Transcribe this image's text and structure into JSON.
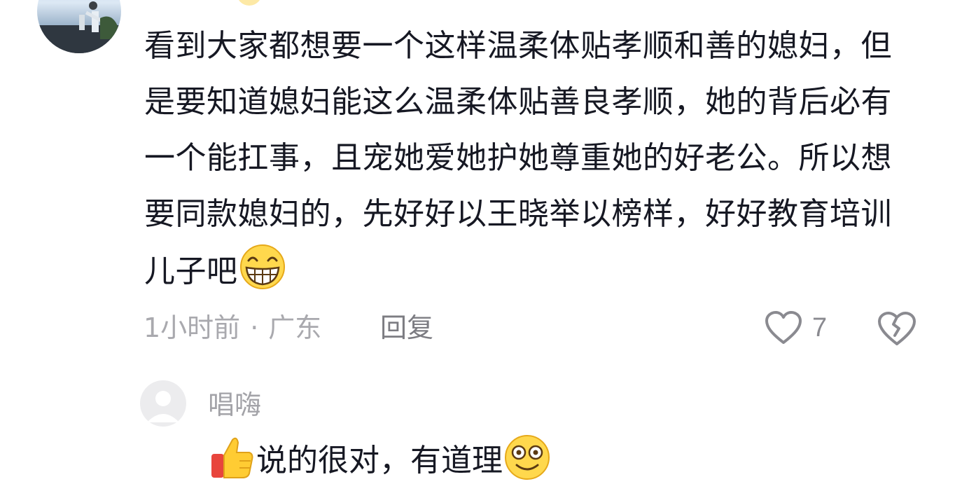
{
  "main_comment": {
    "partial_username": "",
    "text": "看到大家都想要一个这样温柔体贴孝顺和善的媳妇，但是要知道媳妇能这么温柔体贴善良孝顺，她的背后必有一个能扛事，且宠她爱她护她尊重她的好老公。所以想要同款媳妇的，先好好以王晓举以榜样，好好教育培训儿子吧",
    "trailing_emoji": "grinning-face-emoji",
    "time": "1小时前",
    "separator": "·",
    "location": "广东",
    "reply_label": "回复",
    "like_count": "7",
    "icons": {
      "like": "heart-outline-icon",
      "dislike": "broken-heart-icon"
    }
  },
  "reply_comment": {
    "username": "唱嗨",
    "leading_emoji": "thumbs-up-emoji",
    "text": "说的很对，有道理",
    "trailing_emoji": "dizzy-smile-emoji"
  },
  "colors": {
    "text": "#161823",
    "meta": "#a9a9ae",
    "icon": "#8a8a90"
  }
}
